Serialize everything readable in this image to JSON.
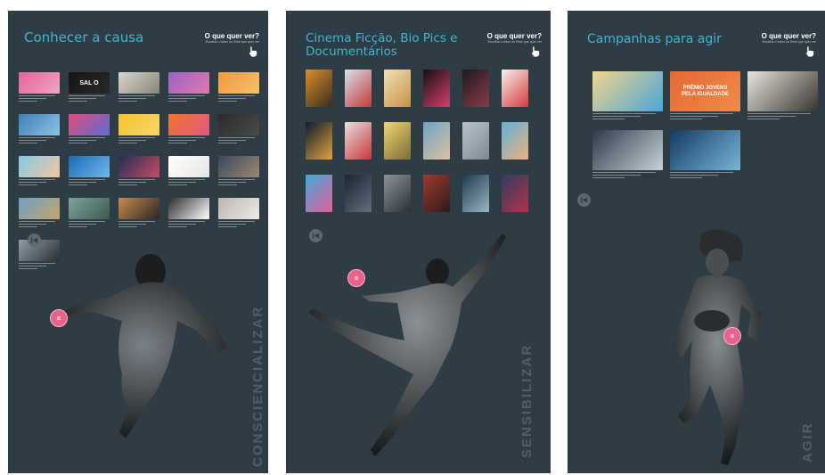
{
  "cta": {
    "question": "O que quer ver?",
    "subtitle": "Escolha o vídeo ou filme que quer ver"
  },
  "panels": [
    {
      "title": "Conhecer a causa",
      "vertical_word": "CONSCIENCIALIZAR",
      "athlete": "swimmer",
      "thumbs": [
        {
          "colors": [
            "#e3629a",
            "#f0a6c6"
          ],
          "logo": ""
        },
        {
          "colors": [
            "#141414",
            "#2a2a2a"
          ],
          "logo": "SAL O"
        },
        {
          "colors": [
            "#d8d5cc",
            "#8a8676"
          ],
          "logo": ""
        },
        {
          "colors": [
            "#9b62c9",
            "#e07aa9"
          ],
          "logo": ""
        },
        {
          "colors": [
            "#f19a3d",
            "#f5c06c"
          ],
          "logo": ""
        },
        {
          "colors": [
            "#3f7fb7",
            "#8fc3e3"
          ],
          "logo": ""
        },
        {
          "colors": [
            "#e44b7c",
            "#5b6fd6"
          ],
          "logo": ""
        },
        {
          "colors": [
            "#f4c42c",
            "#f5d66a"
          ],
          "logo": ""
        },
        {
          "colors": [
            "#f0752f",
            "#e0567d"
          ],
          "logo": ""
        },
        {
          "colors": [
            "#2b2b2b",
            "#4a4a4a"
          ],
          "logo": ""
        },
        {
          "colors": [
            "#83cbe4",
            "#f3c6a0"
          ],
          "logo": ""
        },
        {
          "colors": [
            "#1a6bb8",
            "#70b8e8"
          ],
          "logo": ""
        },
        {
          "colors": [
            "#20304f",
            "#c84a6a"
          ],
          "logo": ""
        },
        {
          "colors": [
            "#ffffff",
            "#e5e5e5"
          ],
          "logo": ""
        },
        {
          "colors": [
            "#374b5f",
            "#a08671"
          ],
          "logo": ""
        },
        {
          "colors": [
            "#6fa0c2",
            "#c5a56b"
          ],
          "logo": ""
        },
        {
          "colors": [
            "#7da3a0",
            "#3c5a4b"
          ],
          "logo": ""
        },
        {
          "colors": [
            "#c88a4d",
            "#2b2624"
          ],
          "logo": ""
        },
        {
          "colors": [
            "#2d2d2d",
            "#ffffff"
          ],
          "logo": ""
        },
        {
          "colors": [
            "#b9b4ad",
            "#efece7"
          ],
          "logo": ""
        },
        {
          "colors": [
            "#8d9fa8",
            "#2a2f33"
          ],
          "logo": ""
        }
      ]
    },
    {
      "title": "Cinema Ficção, Bio Pics e Documentários",
      "vertical_word": "SENSIBILIZAR",
      "athlete": "gymnast",
      "thumbs": [
        {
          "colors": [
            "#d9902b",
            "#3a2b1f"
          ],
          "logo": ""
        },
        {
          "colors": [
            "#d8e3ee",
            "#c43a3a"
          ],
          "logo": ""
        },
        {
          "colors": [
            "#f0e0b4",
            "#ca9144"
          ],
          "logo": ""
        },
        {
          "colors": [
            "#121317",
            "#d63b6a"
          ],
          "logo": ""
        },
        {
          "colors": [
            "#1b1b1f",
            "#8a3b4a"
          ],
          "logo": ""
        },
        {
          "colors": [
            "#f6f3ef",
            "#d63a3a"
          ],
          "logo": ""
        },
        {
          "colors": [
            "#0d1a2f",
            "#e0a33c"
          ],
          "logo": ""
        },
        {
          "colors": [
            "#e6e2de",
            "#c8363b"
          ],
          "logo": ""
        },
        {
          "colors": [
            "#efd76b",
            "#7a6b3a"
          ],
          "logo": ""
        },
        {
          "colors": [
            "#6ba5c4",
            "#e0c0a0"
          ],
          "logo": ""
        },
        {
          "colors": [
            "#b7c4cc",
            "#7c8b93"
          ],
          "logo": ""
        },
        {
          "colors": [
            "#5fb3d6",
            "#f0b07d"
          ],
          "logo": ""
        },
        {
          "colors": [
            "#41a9d8",
            "#e85d9b"
          ],
          "logo": ""
        },
        {
          "colors": [
            "#1a2432",
            "#606e7d"
          ],
          "logo": ""
        },
        {
          "colors": [
            "#8a949c",
            "#2b3135"
          ],
          "logo": ""
        },
        {
          "colors": [
            "#a13a2a",
            "#2a1b1b"
          ],
          "logo": ""
        },
        {
          "colors": [
            "#1c3a4f",
            "#9bb6c2"
          ],
          "logo": ""
        },
        {
          "colors": [
            "#2c3f5f",
            "#b62f4a"
          ],
          "logo": ""
        }
      ]
    },
    {
      "title": "Campanhas para agir",
      "vertical_word": "AGIR",
      "athlete": "rugby",
      "thumbs": [
        {
          "colors": [
            "#f3d48c",
            "#4aa6d8"
          ],
          "logo": ""
        },
        {
          "colors": [
            "#e36a35",
            "#f08a4a"
          ],
          "logo": "PRÉMIO JOVENS PELA IGUALDADE"
        },
        {
          "colors": [
            "#e9e4dc",
            "#3a3431"
          ],
          "logo": ""
        },
        {
          "colors": [
            "#2a3b48",
            "#c7d3d8"
          ],
          "logo": ""
        },
        {
          "colors": [
            "#123a5f",
            "#79b5da"
          ],
          "logo": ""
        }
      ]
    }
  ]
}
